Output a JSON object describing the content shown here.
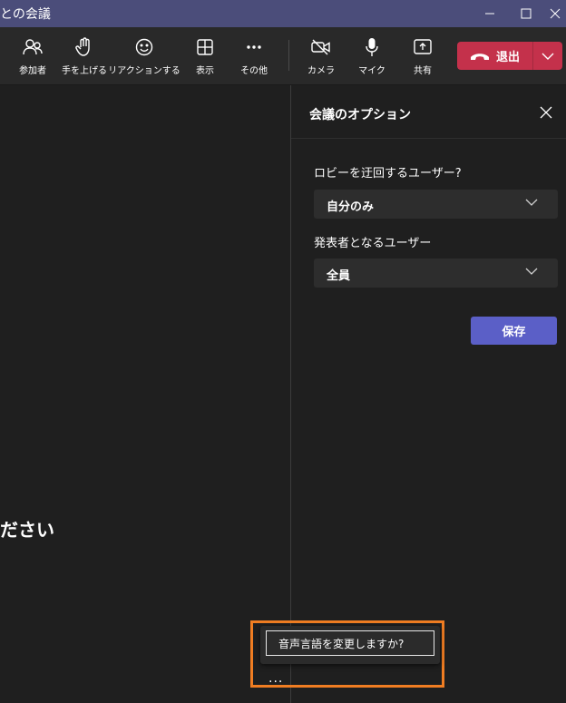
{
  "window": {
    "title": "との会議",
    "controls": [
      "minimize-icon",
      "maximize-icon",
      "close-icon"
    ]
  },
  "toolbar": {
    "participants": {
      "label": "参加者",
      "icon": "people-icon"
    },
    "raise_hand": {
      "label": "手を上げる",
      "icon": "hand-icon"
    },
    "reactions": {
      "label": "リアクションする",
      "icon": "smile-icon"
    },
    "view": {
      "label": "表示",
      "icon": "grid-icon"
    },
    "more": {
      "label": "その他",
      "icon": "ellipsis-icon"
    },
    "camera": {
      "label": "カメラ",
      "icon": "camera-off-icon"
    },
    "mic": {
      "label": "マイク",
      "icon": "microphone-icon"
    },
    "share": {
      "label": "共有",
      "icon": "share-icon"
    },
    "leave": {
      "label": "退出",
      "icon": "phone-hangup-icon",
      "color": "#c4314b"
    }
  },
  "stage": {
    "text": "ださい"
  },
  "options_panel": {
    "title": "会議のオプション",
    "lobby_bypass": {
      "label": "ロビーを迂回するユーザー?",
      "value": "自分のみ"
    },
    "presenters": {
      "label": "発表者となるユーザー",
      "value": "全員"
    },
    "save_label": "保存",
    "accent_color": "#5b5fc7"
  },
  "popup": {
    "item_label": "音声言語を変更しますか?",
    "more_label": "...",
    "highlight_color": "#f07d22"
  }
}
